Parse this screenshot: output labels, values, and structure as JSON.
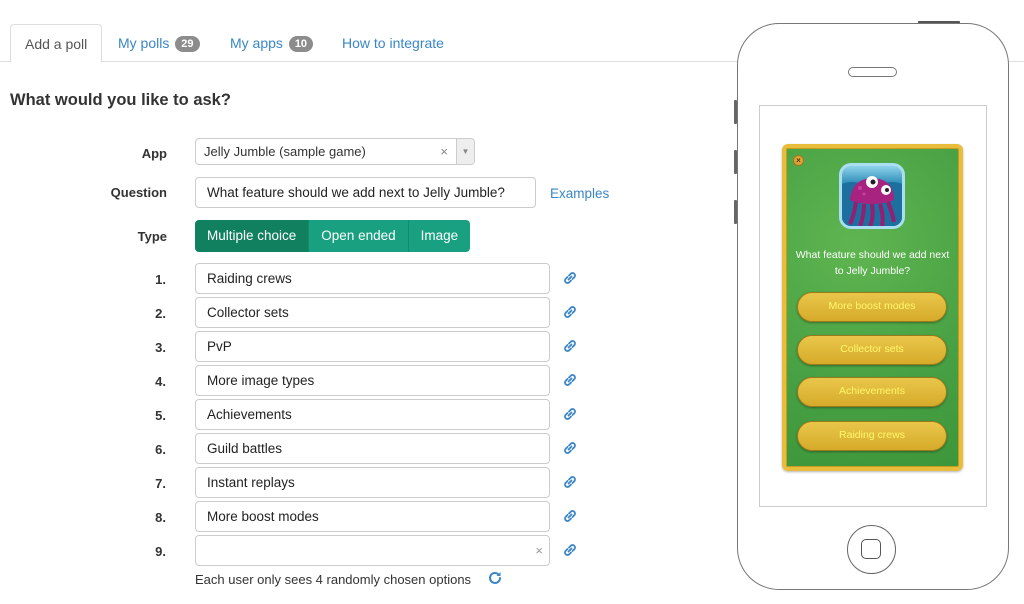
{
  "tabs": [
    {
      "label": "Add a poll",
      "active": true
    },
    {
      "label": "My polls",
      "badge": "29"
    },
    {
      "label": "My apps",
      "badge": "10"
    },
    {
      "label": "How to integrate"
    }
  ],
  "heading": "What would you like to ask?",
  "form": {
    "app_label": "App",
    "app_value": "Jelly Jumble (sample game)",
    "app_clear": "×",
    "app_arrow": "▼",
    "question_label": "Question",
    "question_value": "What feature should we add next to Jelly Jumble?",
    "examples_link": "Examples",
    "type_label": "Type",
    "types": [
      "Multiple choice",
      "Open ended",
      "Image"
    ],
    "selected_type": "Multiple choice",
    "options": [
      {
        "num": "1.",
        "value": "Raiding crews"
      },
      {
        "num": "2.",
        "value": "Collector sets"
      },
      {
        "num": "3.",
        "value": "PvP"
      },
      {
        "num": "4.",
        "value": "More image types"
      },
      {
        "num": "5.",
        "value": "Achievements"
      },
      {
        "num": "6.",
        "value": "Guild battles"
      },
      {
        "num": "7.",
        "value": "Instant replays"
      },
      {
        "num": "8.",
        "value": "More boost modes"
      },
      {
        "num": "9.",
        "value": ""
      }
    ],
    "option_clear": "×",
    "hint": "Each user only sees 4 randomly chosen options"
  },
  "preview": {
    "close": "×",
    "question": "What feature should we add next to Jelly Jumble?",
    "buttons": [
      "More boost modes",
      "Collector sets",
      "Achievements",
      "Raiding crews"
    ]
  },
  "colors": {
    "link": "#3a86c8",
    "type_active": "#11805f",
    "type_inactive": "#19a080",
    "game_bg": "#47a043",
    "game_button": "#d6ab2a",
    "game_button_text": "#fff86a"
  }
}
